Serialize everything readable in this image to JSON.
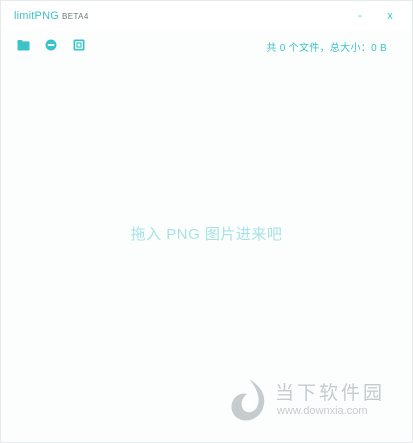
{
  "window": {
    "title": "limitPNG",
    "beta": "BETA4",
    "minimize_label": "-",
    "close_label": "x"
  },
  "toolbar": {
    "icons": [
      "folder-icon",
      "clear-icon",
      "settings-icon"
    ],
    "summary": "共 0 个文件，总大小：0 B"
  },
  "dropzone": {
    "hint": "拖入 PNG 图片进来吧"
  },
  "watermark": {
    "brand": "当下软件园",
    "url": "www.downxia.com"
  },
  "colors": {
    "accent": "#3cc3c8",
    "hint": "#a6e3e6",
    "watermark": "#9aa4a8"
  }
}
